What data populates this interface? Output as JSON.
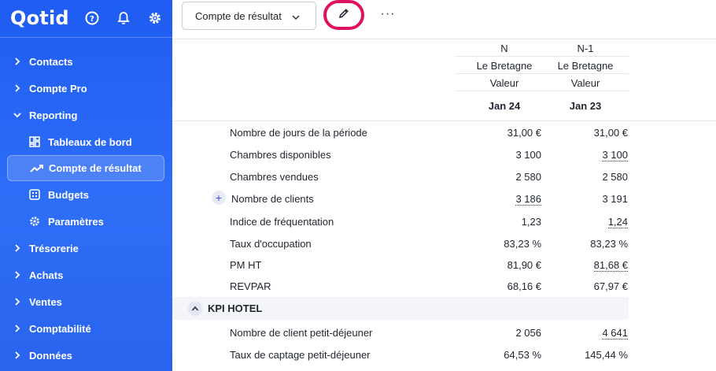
{
  "app": {
    "logo": "Qotid"
  },
  "sidebar": {
    "items": [
      {
        "label": "Contacts"
      },
      {
        "label": "Compte Pro"
      },
      {
        "label": "Reporting"
      }
    ],
    "reporting_sub": [
      {
        "label": "Tableaux de bord",
        "icon": "dashboard-icon"
      },
      {
        "label": "Compte de résultat",
        "icon": "trend-up-icon"
      },
      {
        "label": "Budgets",
        "icon": "calculator-icon"
      },
      {
        "label": "Paramètres",
        "icon": "gear-icon"
      }
    ],
    "items_after": [
      {
        "label": "Trésorerie"
      },
      {
        "label": "Achats"
      },
      {
        "label": "Ventes"
      },
      {
        "label": "Comptabilité"
      },
      {
        "label": "Données"
      }
    ]
  },
  "toolbar": {
    "report_select": "Compte de résultat",
    "more": "···"
  },
  "table": {
    "columns": [
      {
        "period": "N",
        "entity": "Le Bretagne",
        "measure": "Valeur",
        "date": "Jan 24"
      },
      {
        "period": "N-1",
        "entity": "Le Bretagne",
        "measure": "Valeur",
        "date": "Jan 23"
      }
    ],
    "rows": [
      {
        "label": "Nombre de jours de la période",
        "v1": "31,00 €",
        "v2": "31,00 €"
      },
      {
        "label": "Chambres disponibles",
        "v1": "3 100",
        "v2": "3 100"
      },
      {
        "label": "Chambres vendues",
        "v1": "2 580",
        "v2": "2 580"
      },
      {
        "label": "Nombre de clients",
        "v1": "3 186",
        "v2": "3 191"
      },
      {
        "label": "Indice de fréquentation",
        "v1": "1,23",
        "v2": "1,24"
      },
      {
        "label": "Taux d'occupation",
        "v1": "83,23 %",
        "v2": "83,23 %"
      },
      {
        "label": "PM HT",
        "v1": "81,90 €",
        "v2": "81,68 €"
      },
      {
        "label": "REVPAR",
        "v1": "68,16 €",
        "v2": "67,97 €"
      }
    ],
    "section": {
      "title": "KPI HOTEL"
    },
    "section_rows": [
      {
        "label": "Nombre de client petit-déjeuner",
        "v1": "2 056",
        "v2": "4 641"
      },
      {
        "label": "Taux de captage petit-déjeuner",
        "v1": "64,53 %",
        "v2": "145,44 %"
      }
    ]
  }
}
